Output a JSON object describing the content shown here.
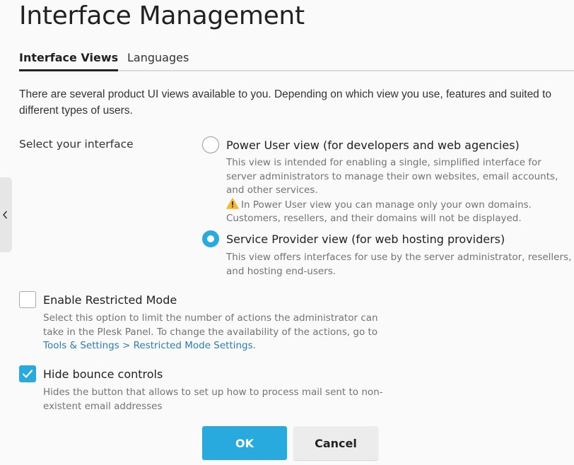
{
  "header": {
    "title": "Interface Management"
  },
  "tabs": [
    {
      "label": "Interface Views",
      "active": true
    },
    {
      "label": "Languages",
      "active": false
    }
  ],
  "intro": "There are several product UI views available to you. Depending on which view you use, features and suited to different types of users.",
  "interface_select": {
    "label": "Select your interface",
    "options": [
      {
        "label": "Power User view (for developers and web agencies)",
        "checked": false,
        "description": "This view is intended for enabling a single, simplified interface for server administrators to manage their own websites, email accounts, and other services.",
        "warning_icon": "warning-icon",
        "warning": "In Power User view you can manage only your own domains. Customers, resellers, and their domains will not be displayed."
      },
      {
        "label": "Service Provider view (for web hosting providers)",
        "checked": true,
        "description": "This view offers interfaces for use by the server administrator, resellers, and hosting end-users."
      }
    ]
  },
  "restricted_mode": {
    "label": "Enable Restricted Mode",
    "checked": false,
    "description": "Select this option to limit the number of actions the administrator can take in the Plesk Panel. To change the availability of the actions, go to",
    "link": "Tools & Settings > Restricted Mode Settings",
    "link_suffix": "."
  },
  "bounce_controls": {
    "label": "Hide bounce controls",
    "checked": true,
    "check_icon": "checkmark-icon",
    "description": "Hides the button that allows to set up how to process mail sent to non-existent email addresses"
  },
  "buttons": {
    "ok": "OK",
    "cancel": "Cancel"
  },
  "side_toggle": {
    "icon": "chevron-left-icon"
  },
  "colors": {
    "accent": "#28aade",
    "link": "#2a7db6",
    "muted_text": "#737373"
  }
}
